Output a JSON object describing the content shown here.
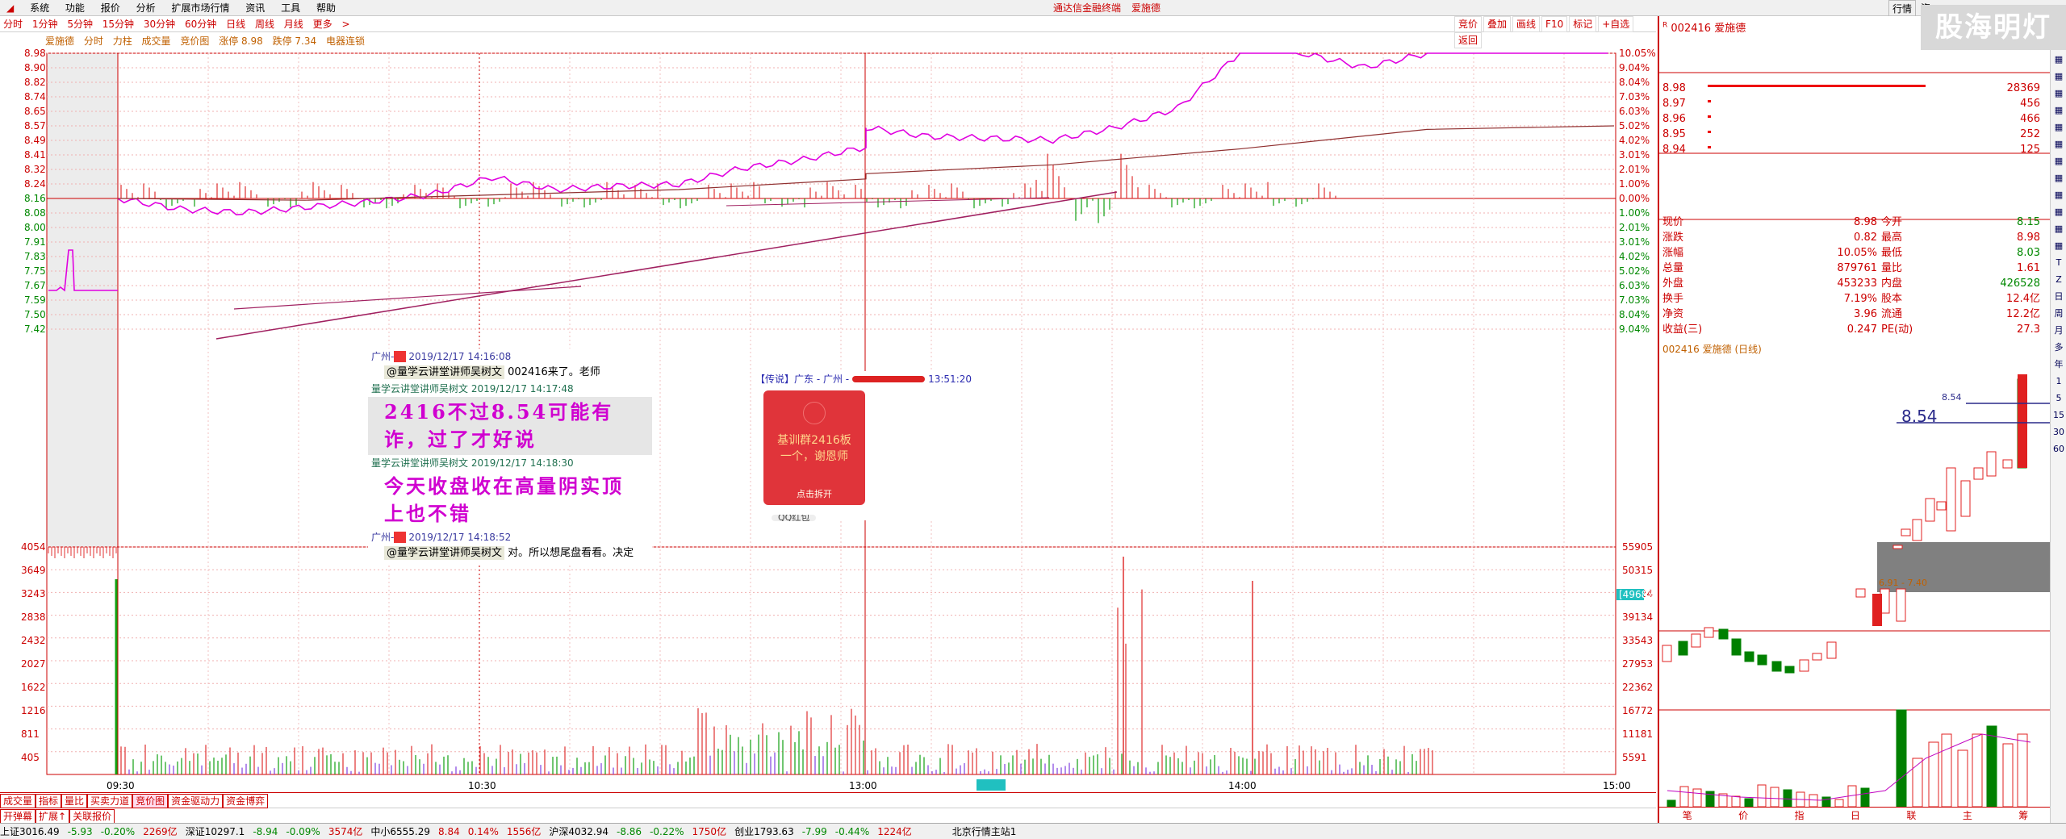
{
  "menu": {
    "items": [
      "系统",
      "功能",
      "报价",
      "分析",
      "扩展市场行情",
      "资讯",
      "工具",
      "帮助"
    ],
    "center_title": "通达信金融终端",
    "stock_name_menu": "爱施德",
    "right_items": [
      "行情",
      "资"
    ]
  },
  "timeframes": [
    "分时",
    "1分钟",
    "5分钟",
    "15分钟",
    "30分钟",
    "60分钟",
    "日线",
    "周线",
    "月线",
    "更多",
    ">"
  ],
  "toolbar_right": [
    "竞价",
    "叠加",
    "画线",
    "F10",
    "标记",
    "+自选",
    "返回"
  ],
  "info": {
    "name": "爱施德",
    "tabs": [
      "分时",
      "力柱",
      "成交量",
      "竞价图",
      "涨停 8.98",
      "跌停 7.34",
      "电器连锁"
    ]
  },
  "price_ticks": [
    "8.98",
    "8.90",
    "8.82",
    "8.74",
    "8.65",
    "8.57",
    "8.49",
    "8.41",
    "8.32",
    "8.24",
    "8.16",
    "8.08",
    "8.00",
    "7.91",
    "7.83",
    "7.75",
    "7.67",
    "7.59",
    "7.50",
    "7.42"
  ],
  "pct_ticks": [
    "10.05%",
    "9.04%",
    "8.04%",
    "7.03%",
    "6.03%",
    "5.02%",
    "4.02%",
    "3.01%",
    "2.01%",
    "1.00%",
    "0.00%",
    "1.00%",
    "2.01%",
    "3.01%",
    "4.02%",
    "5.02%",
    "6.03%",
    "7.03%",
    "8.04%",
    "9.04%"
  ],
  "vol_ticks_left": [
    "4054",
    "3649",
    "3243",
    "2838",
    "2432",
    "2027",
    "1622",
    "1216",
    "811",
    "405"
  ],
  "vol_ticks_right": [
    "55905",
    "50315",
    "44724",
    "39134",
    "33543",
    "27953",
    "22362",
    "16772",
    "11181",
    "5591"
  ],
  "vol_highlight": "[49687]",
  "time_ticks": [
    "09:30",
    "10:30",
    "13:00",
    "14:00",
    "15:00"
  ],
  "chart_data": {
    "type": "line",
    "title": "",
    "xlabel": "",
    "ylabel": "",
    "ylim": [
      7.34,
      8.98
    ],
    "prev_close": 8.16,
    "series": [
      {
        "x": [
          "09:30",
          "09:40",
          "09:50",
          "10:00",
          "10:10",
          "10:20",
          "10:30",
          "10:40",
          "10:50",
          "11:00",
          "11:10",
          "11:20",
          "11:30",
          "13:00",
          "13:10",
          "13:20",
          "13:30",
          "13:40",
          "13:50",
          "14:00",
          "14:10",
          "14:20",
          "14:30",
          "14:40",
          "14:50",
          "15:00"
        ],
        "values": [
          8.16,
          8.1,
          8.08,
          8.11,
          8.14,
          8.18,
          8.28,
          8.21,
          8.23,
          8.24,
          8.33,
          8.38,
          8.45,
          8.56,
          8.51,
          8.5,
          8.49,
          8.56,
          8.67,
          8.98,
          8.98,
          8.9,
          8.98,
          8.98,
          8.98,
          8.98
        ]
      },
      {
        "x": [
          "09:30",
          "10:00",
          "10:30",
          "11:00",
          "11:30",
          "13:00",
          "13:30",
          "14:00",
          "14:30",
          "15:00"
        ],
        "values": [
          8.16,
          8.15,
          8.18,
          8.21,
          8.27,
          8.3,
          8.35,
          8.44,
          8.55,
          8.57
        ]
      }
    ]
  },
  "chat": {
    "m1_meta": "广州-",
    "m1_time": "2019/12/17 14:16:08",
    "m1_tag": "@量学云讲堂讲师吴树文",
    "m1_text": "002416来了。老师",
    "m2_meta": "量学云讲堂讲师吴树文 2019/12/17 14:17:48",
    "m2_text": "2416不过8.54可能有诈，过了才好说",
    "m3_meta": "量学云讲堂讲师吴树文 2019/12/17 14:18:30",
    "m3_text": "今天收盘收在高量阴实顶上也不错",
    "m4_meta": "广州-",
    "m4_time": "2019/12/17 14:18:52",
    "m4_tag": "@量学云讲堂讲师吴树文",
    "m4_text": "对。所以想尾盘看看。决定"
  },
  "redpacket": {
    "head": "【传说】广东 - 广州 -",
    "time": "13:51:20",
    "line1": "基训群2416板",
    "line2": "一个，谢恩师",
    "open": "点击拆开",
    "btn": "QQ红包"
  },
  "side": {
    "code": "002416",
    "name": "爱施德",
    "bids": [
      {
        "p": "8.98",
        "v": "28369"
      },
      {
        "p": "8.97",
        "v": "456"
      },
      {
        "p": "8.96",
        "v": "466"
      },
      {
        "p": "8.95",
        "v": "252"
      },
      {
        "p": "8.94",
        "v": "125"
      }
    ],
    "quote": [
      [
        "现价",
        "8.98",
        "今开",
        "8.15"
      ],
      [
        "涨跌",
        "0.82",
        "最高",
        "8.98"
      ],
      [
        "涨幅",
        "10.05%",
        "最低",
        "8.03"
      ],
      [
        "总量",
        "879761",
        "量比",
        "1.61"
      ],
      [
        "外盘",
        "453233",
        "内盘",
        "426528"
      ],
      [
        "换手",
        "7.19%",
        "股本",
        "12.4亿"
      ],
      [
        "净资",
        "3.96",
        "流通",
        "12.2亿"
      ],
      [
        "收益(三)",
        "0.247",
        "PE(动)",
        "27.3"
      ]
    ],
    "daily_title": "002416 爱施德 (日线)",
    "price_label": "8.54",
    "price_label_small": "8.54",
    "range_label": "6.91 - 7.40",
    "bottom_tabs": [
      "笔",
      "价",
      "指",
      "日",
      "联",
      "主",
      "筹"
    ]
  },
  "iconcol": [
    "T",
    "Z",
    "日",
    "周",
    "月",
    "多",
    "年",
    "1",
    "5",
    "15",
    "30",
    "60"
  ],
  "bottom_tabs": [
    "成交量",
    "指标",
    "量比",
    "买卖力道",
    "竞价图",
    "资金驱动力",
    "资金博弈"
  ],
  "bottom_tabs2": [
    "开弹幕",
    "扩展↑",
    "关联报价"
  ],
  "status": {
    "items": [
      "上证3016.49",
      "-5.93",
      "-0.20%",
      "2269亿",
      "深证10297.1",
      "-8.94",
      "-0.09%",
      "3574亿",
      "中小6555.29",
      "8.84",
      "0.14%",
      "1556亿",
      "沪深4032.94",
      "-8.86",
      "-0.22%",
      "1750亿",
      "创业1793.63",
      "-7.99",
      "-0.44%",
      "1224亿"
    ],
    "server": "北京行情主站1"
  },
  "watermark": "股海明灯"
}
